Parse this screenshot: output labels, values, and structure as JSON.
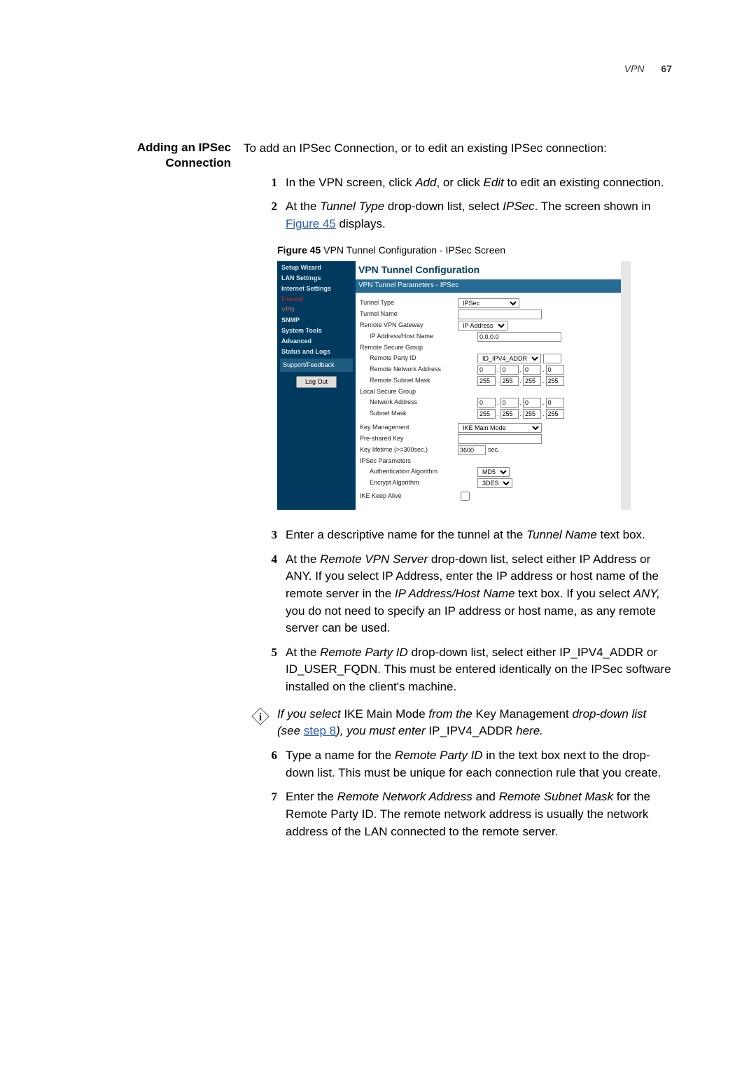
{
  "header": {
    "section": "VPN",
    "page": "67"
  },
  "heading": {
    "line1": "Adding an IPSec",
    "line2": "Connection"
  },
  "intro": "To add an IPSec Connection, or to edit an existing IPSec connection:",
  "steps": {
    "s1a": "In the VPN screen, click ",
    "s1add": "Add",
    "s1b": ", or click ",
    "s1edit": "Edit",
    "s1c": " to edit an existing connection.",
    "s2a": "At the ",
    "s2tt": "Tunnel Type",
    "s2b": " drop-down list, select ",
    "s2ip": "IPSec",
    "s2c": ". The screen shown in ",
    "s2link": "Figure 45",
    "s2d": " displays.",
    "s3a": "Enter a descriptive name for the tunnel at the ",
    "s3tn": "Tunnel Name",
    "s3b": " text box.",
    "s4a": "At the ",
    "s4rvs": "Remote VPN Server",
    "s4b": " drop-down list, select either IP Address or ANY. If you select IP Address, enter the IP address or host name of the remote server in the ",
    "s4ip": "IP Address/Host Name",
    "s4c": " text box. If you select ",
    "s4any": "ANY,",
    "s4d": " you do not need to specify an IP address or host name, as any remote server can be used.",
    "s5a": "At the ",
    "s5rp": "Remote Party ID",
    "s5b": " drop-down list, select either IP_IPV4_ADDR or ID_USER_FQDN. This must be entered identically on the IPSec software installed on the client's machine.",
    "s6a": "Type a name for the ",
    "s6rp": "Remote Party ID",
    "s6b": " in the text box next to the drop-down list. This must be unique for each connection rule that you create.",
    "s7a": "Enter the ",
    "s7rna": "Remote Network Address",
    "s7b": " and ",
    "s7rsm": "Remote Subnet Mask",
    "s7c": " for the Remote Party ID. The remote network address is usually the network address of the LAN connected to the remote server."
  },
  "figure": {
    "label": "Figure 45",
    "caption": "   VPN Tunnel Configuration - IPSec Screen"
  },
  "shot": {
    "nav": {
      "wizard": "Setup Wizard",
      "lan": "LAN Settings",
      "internet": "Internet Settings",
      "firewall": "Firewall",
      "vpn": "VPN",
      "snmp": "SNMP",
      "systools": "System Tools",
      "advanced": "Advanced",
      "status": "Status and Logs",
      "support": "Support/Feedback",
      "logout": "Log Out"
    },
    "title": "VPN Tunnel Configuration",
    "bar": "VPN Tunnel Parameters - IPSec",
    "labels": {
      "tunneltype": "Tunnel Type",
      "tunnelname": "Tunnel Name",
      "remotevpn": "Remote VPN Gateway",
      "ipaddrhost": "IP Address/Host Name",
      "rsg": "Remote Secure Group",
      "rpid": "Remote Party ID",
      "rna": "Remote Network Address",
      "rsm": "Remote Subnet Mask",
      "lsg": "Local Secure Group",
      "na": "Network Address",
      "sm": "Subnet Mask",
      "km": "Key Management",
      "psk": "Pre-shared Key",
      "kl": "Key lifetime (>=300sec.)",
      "ipp": "IPSec Parameters",
      "aa": "Authentication Algorithm",
      "ea": "Encrypt Algorithm",
      "ika": "IKE Keep Alive"
    },
    "values": {
      "ipsec": "IPSec",
      "ipaddr": "IP Address",
      "iphost": "0.0.0.0",
      "rpid": "ID_IPV4_ADDR",
      "ip0": "0",
      "ip255": "255",
      "km": "IKE Main Mode",
      "kl": "3600",
      "sec": "sec.",
      "md5": "MD5",
      "des": "3DES"
    }
  },
  "info": {
    "a": "If you select ",
    "b": "IKE Main Mode ",
    "c": "from the ",
    "d": "Key Management ",
    "e": "drop-down list (see ",
    "link": "step 8",
    "f": "), you must enter ",
    "g": "IP_IPV4_ADDR ",
    "h": "here."
  },
  "nums": {
    "n1": "1",
    "n2": "2",
    "n3": "3",
    "n4": "4",
    "n5": "5",
    "n6": "6",
    "n7": "7"
  }
}
